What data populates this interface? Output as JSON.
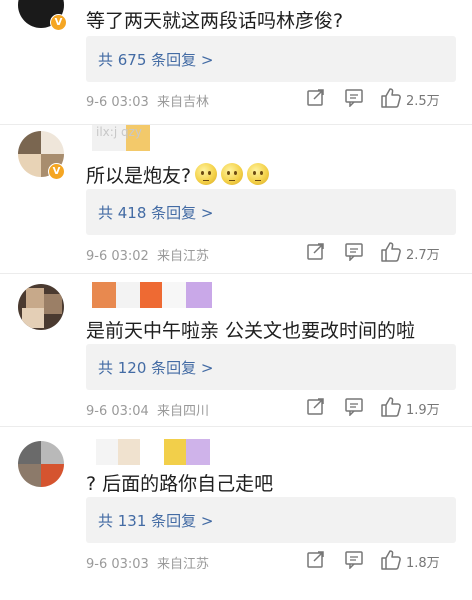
{
  "comments": [
    {
      "text": "等了两天就这两段话吗林彦俊?",
      "reply": "共 675 条回复 >",
      "time": "9-6 03:03",
      "location": "来自吉林",
      "likes": "2.5万",
      "verified_mark": "V"
    },
    {
      "text": "所以是炮友?",
      "reply": "共 418 条回复 >",
      "time": "9-6 03:02",
      "location": "来自江苏",
      "likes": "2.7万",
      "username_fragment": "ilx:j qzy",
      "verified_mark": "V"
    },
    {
      "text": "是前天中午啦亲 公关文也要改时间的啦",
      "reply": "共 120 条回复 >",
      "time": "9-6 03:04",
      "location": "来自四川",
      "likes": "1.9万"
    },
    {
      "text": "? 后面的路你自己走吧",
      "reply": "共 131 条回复 >",
      "time": "9-6 03:03",
      "location": "来自江苏",
      "likes": "1.8万"
    }
  ],
  "colors": {
    "reply_link": "#436ba4",
    "reply_bg": "#f2f2f2",
    "meta": "#9a9a9a",
    "badge": "#f5a623"
  },
  "icons": [
    "share-icon",
    "comment-icon",
    "like-icon",
    "emoji-icon",
    "verified-badge-icon"
  ]
}
